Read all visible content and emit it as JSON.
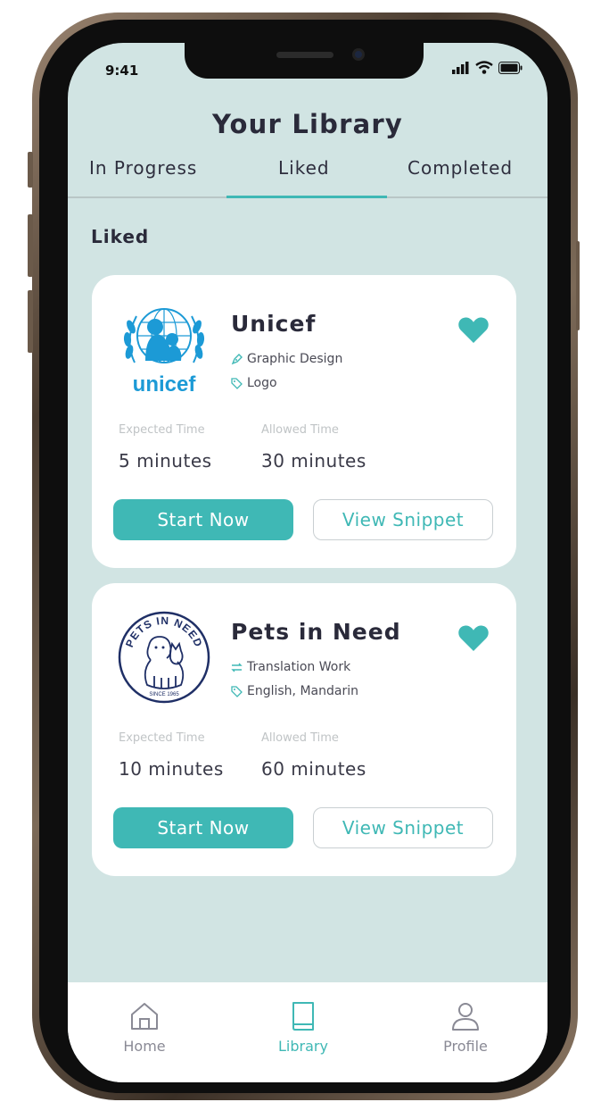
{
  "status_bar": {
    "time": "9:41"
  },
  "header": {
    "title": "Your Library"
  },
  "tabs": [
    {
      "label": "In Progress",
      "active": false
    },
    {
      "label": "Liked",
      "active": true
    },
    {
      "label": "Completed",
      "active": false
    }
  ],
  "section": {
    "title": "Liked"
  },
  "cards": [
    {
      "name": "Unicef",
      "logo_text": "unicef",
      "liked": true,
      "category": "Graphic Design",
      "tag": "Logo",
      "expected_label": "Expected Time",
      "expected_value": "5 minutes",
      "allowed_label": "Allowed Time",
      "allowed_value": "30 minutes",
      "start_label": "Start Now",
      "snippet_label": "View Snippet"
    },
    {
      "name": "Pets in Need",
      "logo_text": "PETS IN NEED",
      "logo_subtext": "SINCE 1965",
      "liked": true,
      "category": "Translation Work",
      "tag": "English, Mandarin",
      "expected_label": "Expected Time",
      "expected_value": "10 minutes",
      "allowed_label": "Allowed Time",
      "allowed_value": "60 minutes",
      "start_label": "Start Now",
      "snippet_label": "View Snippet"
    }
  ],
  "bottom_nav": [
    {
      "label": "Home",
      "icon": "home-icon",
      "active": false
    },
    {
      "label": "Library",
      "icon": "book-icon",
      "active": true
    },
    {
      "label": "Profile",
      "icon": "user-icon",
      "active": false
    }
  ],
  "colors": {
    "accent": "#3fb8b5",
    "background": "#d1e4e3",
    "unicef_blue": "#1c9ad6",
    "pets_navy": "#1f2f66"
  }
}
